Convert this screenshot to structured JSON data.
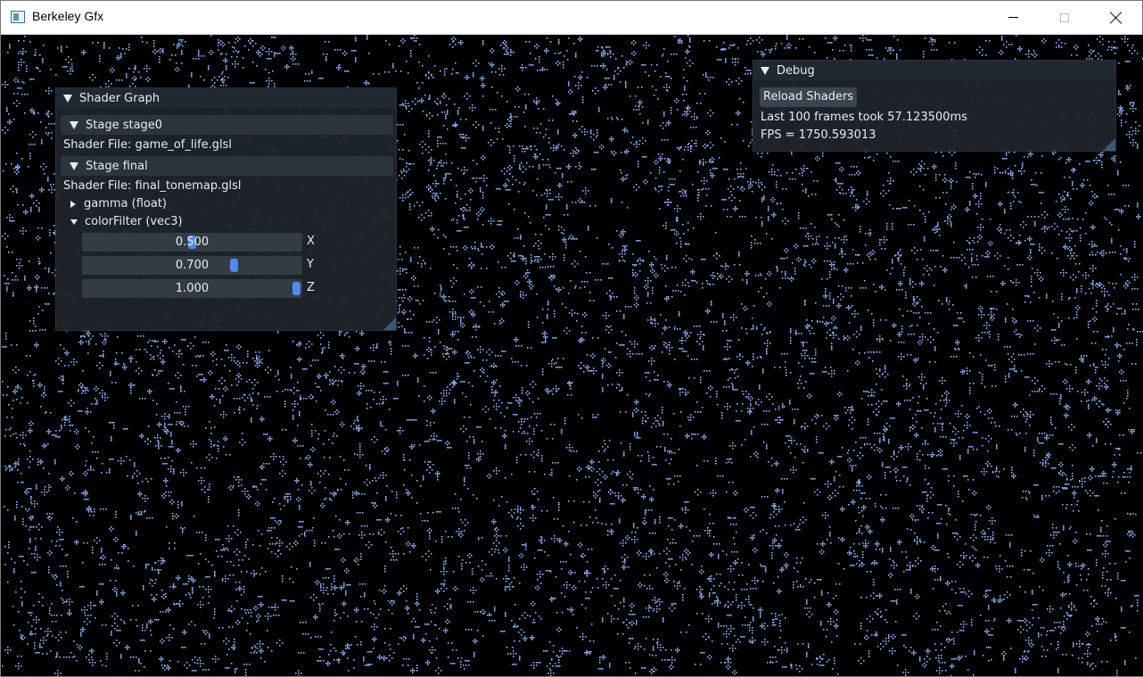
{
  "titlebar": {
    "title": "Berkeley Gfx",
    "icon": "app-icon",
    "controls": [
      "minimize-icon",
      "maximize-icon",
      "close-icon"
    ]
  },
  "colors": {
    "cell_color": "#8fb4ff",
    "panel_bg": "#1e242a",
    "accent": "#4d8bf0"
  },
  "shader_graph": {
    "title": "Shader Graph",
    "stages": [
      {
        "header": "Stage stage0",
        "shader_file": "Shader File: game_of_life.glsl"
      },
      {
        "header": "Stage final",
        "shader_file": "Shader File: final_tonemap.glsl"
      }
    ],
    "uniforms": [
      {
        "label": "gamma (float)",
        "expanded": false
      },
      {
        "label": "colorFilter (vec3)",
        "expanded": true
      }
    ],
    "color_filter": [
      {
        "value_text": "0.500",
        "value": 0.5,
        "axis": "X"
      },
      {
        "value_text": "0.700",
        "value": 0.7,
        "axis": "Y"
      },
      {
        "value_text": "1.000",
        "value": 1.0,
        "axis": "Z"
      }
    ]
  },
  "debug": {
    "title": "Debug",
    "reload_button": "Reload Shaders",
    "frame_time": "Last 100 frames took 57.123500ms",
    "fps": "FPS = 1750.593013"
  }
}
